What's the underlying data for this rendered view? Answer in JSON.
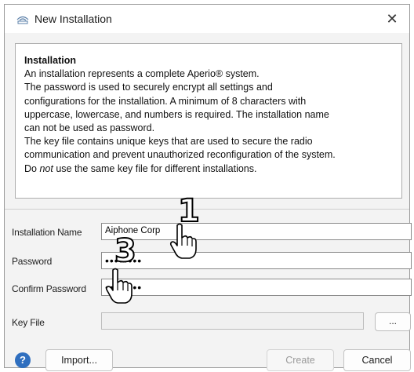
{
  "window": {
    "title": "New Installation",
    "close_glyph": "✕"
  },
  "info": {
    "heading": "Installation",
    "lines": [
      "An installation represents a complete Aperio® system.",
      "The password is used to securely encrypt all settings and",
      "configurations for the installation. A minimum of 8 characters with",
      "uppercase, lowercase, and numbers is required. The installation name",
      "can not be used as password.",
      "The key file contains unique keys that are used to secure the radio",
      "communication and prevent unauthorized reconfiguration of the system."
    ],
    "last_line": {
      "prefix": "Do ",
      "emph": "not",
      "suffix": " use the same key file for different installations."
    }
  },
  "form": {
    "installation_name": {
      "label": "Installation Name",
      "value": "Aiphone Corp"
    },
    "password": {
      "label": "Password",
      "value": "••••••••"
    },
    "confirm_password": {
      "label": "Confirm Password",
      "value": "••••••••"
    },
    "key_file": {
      "label": "Key File",
      "value": "",
      "browse_label": "..."
    }
  },
  "buttons": {
    "help": "?",
    "import": "Import...",
    "create": "Create",
    "cancel": "Cancel"
  },
  "annotations": {
    "step1": "1",
    "step3": "3"
  },
  "icons": [
    "router-icon",
    "close-icon",
    "help-icon",
    "pointer-hand-icon"
  ]
}
